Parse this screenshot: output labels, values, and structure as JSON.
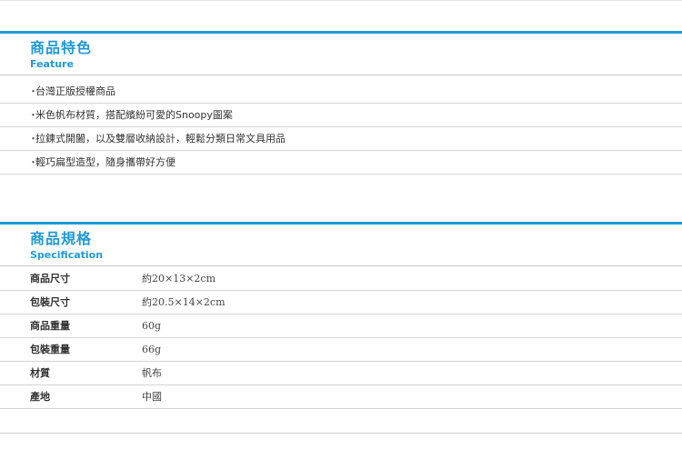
{
  "feature": {
    "title": "商品特色",
    "subtitle": "Feature",
    "bullet": "・",
    "items": [
      "台灣正版授權商品",
      "米色帆布材質，搭配繽紛可愛的Snoopy圖案",
      "拉鍊式開闔，以及雙層收納設計，輕鬆分類日常文具用品",
      "輕巧扁型造型，隨身攜帶好方便"
    ]
  },
  "specification": {
    "title": "商品規格",
    "subtitle": "Specification",
    "rows": [
      {
        "label": "商品尺寸",
        "value": "約20×13×2cm"
      },
      {
        "label": "包裝尺寸",
        "value": "約20.5×14×2cm"
      },
      {
        "label": "商品重量",
        "value": "60g"
      },
      {
        "label": "包裝重量",
        "value": "66g"
      },
      {
        "label": "材質",
        "value": "帆布"
      },
      {
        "label": "產地",
        "value": "中國"
      }
    ]
  },
  "colors": {
    "accent": "#1f9ad6",
    "divider": "#d4d4d4",
    "text": "#333333"
  }
}
